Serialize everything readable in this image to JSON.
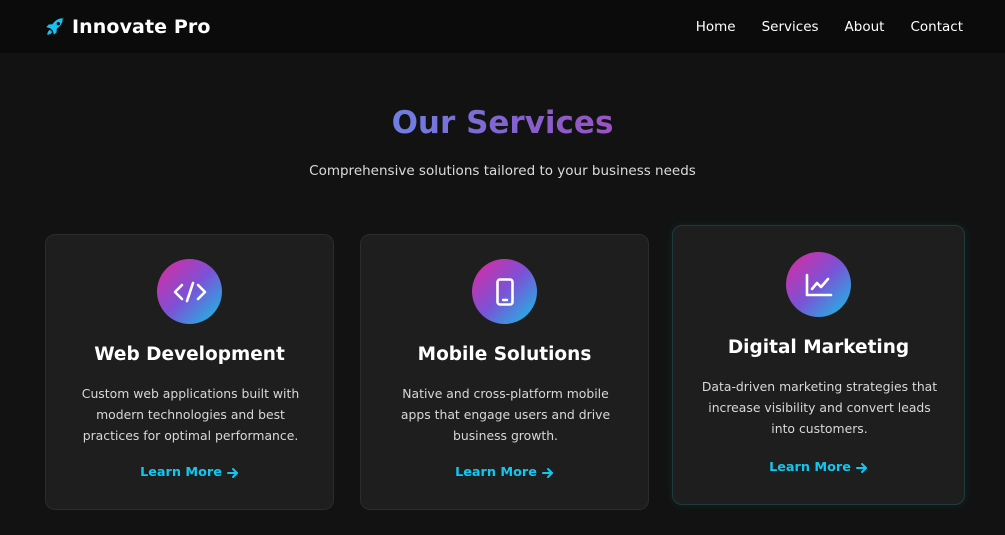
{
  "header": {
    "brand_icon": "rocket-icon",
    "brand_name": "Innovate Pro",
    "nav": [
      {
        "label": "Home"
      },
      {
        "label": "Services"
      },
      {
        "label": "About"
      },
      {
        "label": "Contact"
      }
    ]
  },
  "services": {
    "title": "Our Services",
    "subtitle": "Comprehensive solutions tailored to your business needs",
    "cards": [
      {
        "icon": "code-icon",
        "title": "Web Development",
        "description": "Custom web applications built with modern technologies and best practices for optimal performance.",
        "link_label": "Learn More"
      },
      {
        "icon": "mobile-icon",
        "title": "Mobile Solutions",
        "description": "Native and cross-platform mobile apps that engage users and drive business growth.",
        "link_label": "Learn More"
      },
      {
        "icon": "chart-line-icon",
        "title": "Digital Marketing",
        "description": "Data-driven marketing strategies that increase visibility and convert leads into customers.",
        "link_label": "Learn More"
      }
    ]
  },
  "colors": {
    "background": "#121212",
    "header_background": "#0b0b0b",
    "card_background": "#1e1e1e",
    "accent": "#12c7ef",
    "title_gradient": [
      "#6f7fe3",
      "#9b53c6"
    ],
    "icon_gradient": [
      "#e0289b",
      "#7b52d6",
      "#10c5e6"
    ]
  }
}
